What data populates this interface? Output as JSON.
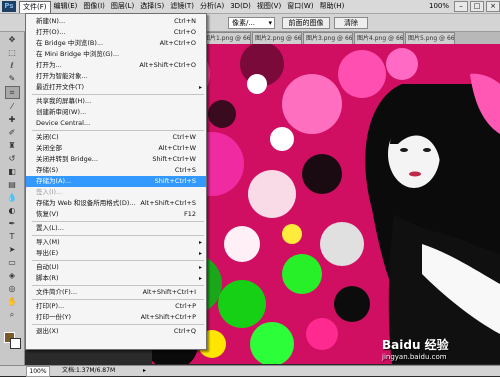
{
  "menubar": {
    "logo": "Ps",
    "items": [
      "文件(F)",
      "编辑(E)",
      "图像(I)",
      "图层(L)",
      "选择(S)",
      "滤镜(T)",
      "分析(A)",
      "3D(D)",
      "视图(V)",
      "窗口(W)",
      "帮助(H)"
    ],
    "zoom": "100%",
    "window_controls": [
      "–",
      "□",
      "×"
    ]
  },
  "options_bar": {
    "combo_1": "像素/...",
    "front_image_button": "前面的图像",
    "clear_button": "清除"
  },
  "tabs": [
    {
      "label": "图片1.png @ 66.7...",
      "close": "×"
    },
    {
      "label": "图片2.png @ 66.7...",
      "close": "×"
    },
    {
      "label": "图片3.png @ 66.7...",
      "close": "×"
    },
    {
      "label": "图片4.png @ 66.7...",
      "close": "×"
    },
    {
      "label": "图片5.png @ 66.7...",
      "close": "×"
    }
  ],
  "file_menu": {
    "items": [
      {
        "label": "新建(N)...",
        "shortcut": "Ctrl+N"
      },
      {
        "label": "打开(O)...",
        "shortcut": "Ctrl+O"
      },
      {
        "label": "在 Bridge 中浏览(B)...",
        "shortcut": "Alt+Ctrl+O"
      },
      {
        "label": "在 Mini Bridge 中浏览(G)...",
        "shortcut": ""
      },
      {
        "label": "打开为...",
        "shortcut": "Alt+Shift+Ctrl+O"
      },
      {
        "label": "打开为智能对象...",
        "shortcut": ""
      },
      {
        "label": "最近打开文件(T)",
        "shortcut": "",
        "submenu": "▸"
      },
      {
        "label": "共享我的屏幕(H)...",
        "shortcut": ""
      },
      {
        "label": "创建新审阅(W)...",
        "shortcut": ""
      },
      {
        "label": "Device Central...",
        "shortcut": ""
      },
      {
        "label": "关闭(C)",
        "shortcut": "Ctrl+W"
      },
      {
        "label": "关闭全部",
        "shortcut": "Alt+Ctrl+W"
      },
      {
        "label": "关闭并转到 Bridge...",
        "shortcut": "Shift+Ctrl+W"
      },
      {
        "label": "存储(S)",
        "shortcut": "Ctrl+S"
      },
      {
        "label": "存储为(A)...",
        "shortcut": "Shift+Ctrl+S"
      },
      {
        "label": "签入(I)...",
        "shortcut": ""
      },
      {
        "label": "存储为 Web 和设备所用格式(D)...",
        "shortcut": "Alt+Shift+Ctrl+S"
      },
      {
        "label": "恢复(V)",
        "shortcut": "F12"
      },
      {
        "label": "置入(L)...",
        "shortcut": ""
      },
      {
        "label": "导入(M)",
        "shortcut": "",
        "submenu": "▸"
      },
      {
        "label": "导出(E)",
        "shortcut": "",
        "submenu": "▸"
      },
      {
        "label": "自动(U)",
        "shortcut": "",
        "submenu": "▸"
      },
      {
        "label": "脚本(R)",
        "shortcut": "",
        "submenu": "▸"
      },
      {
        "label": "文件简介(F)...",
        "shortcut": "Alt+Shift+Ctrl+I"
      },
      {
        "label": "打印(P)...",
        "shortcut": "Ctrl+P"
      },
      {
        "label": "打印一份(Y)",
        "shortcut": "Alt+Shift+Ctrl+P"
      },
      {
        "label": "退出(X)",
        "shortcut": "Ctrl+Q"
      }
    ]
  },
  "status_bar": {
    "zoom": "100%",
    "doc_info": "文档:1.37M/6.87M",
    "arrow": "▸"
  },
  "watermark": {
    "logo": "Baidu 经验",
    "url": "jingyan.baidu.com"
  },
  "colors": {
    "menu_highlight": "#3399ff",
    "foreground_swatch": "#7a5a2a",
    "background_swatch": "#ffffff"
  }
}
